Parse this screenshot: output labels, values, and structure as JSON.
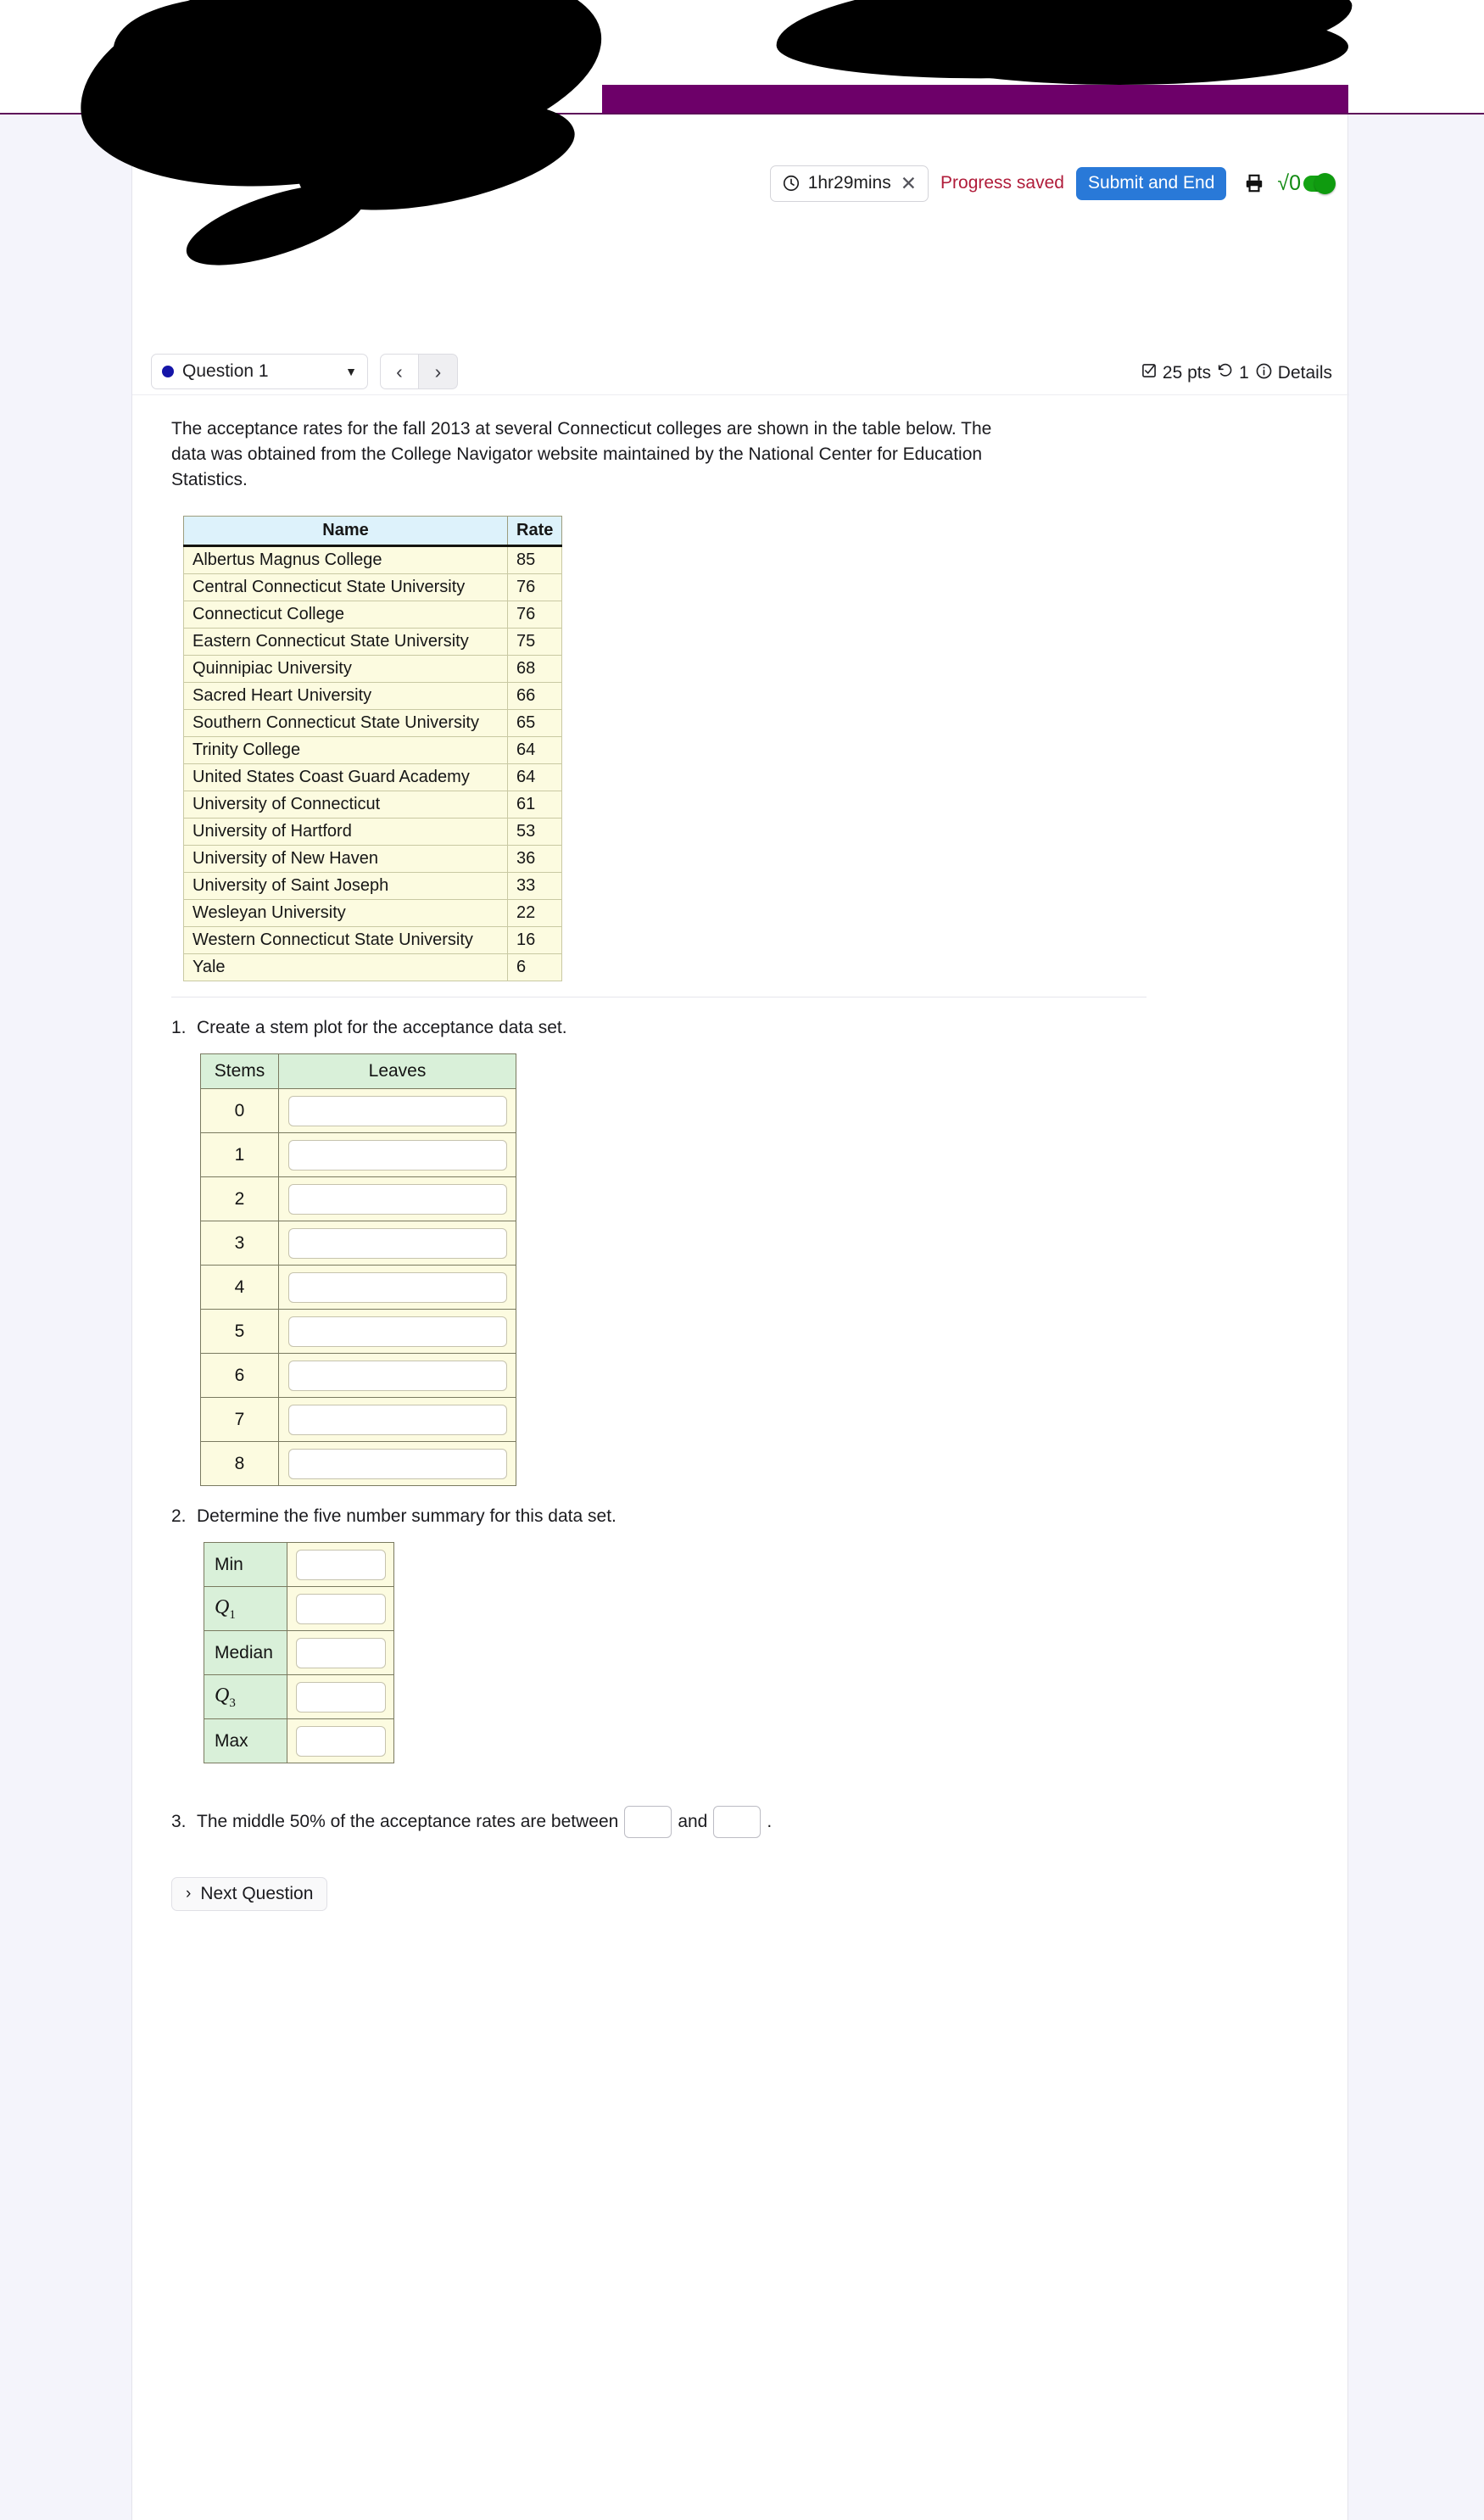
{
  "toolbar": {
    "timer_label": "1hr29mins",
    "timer_close": "✕",
    "progress_saved": "Progress saved",
    "submit_label": "Submit and End",
    "sqrt_glyph": "√0"
  },
  "qnav": {
    "question_label": "Question 1",
    "caret": "▼",
    "prev": "‹",
    "next": "›",
    "points": "25 pts",
    "attempts": "1",
    "details": "Details"
  },
  "main": {
    "prompt": "The acceptance rates for the fall 2013 at several Connecticut colleges are shown in the table below. The data was obtained from the College Navigator website maintained by the National Center for Education Statistics.",
    "next_question_label": "Next Question",
    "next_question_chevron": "›"
  },
  "data_table": {
    "headers": [
      "Name",
      "Rate"
    ],
    "rows": [
      [
        "Albertus Magnus College",
        "85"
      ],
      [
        "Central Connecticut State University",
        "76"
      ],
      [
        "Connecticut College",
        "76"
      ],
      [
        "Eastern Connecticut State University",
        "75"
      ],
      [
        "Quinnipiac University",
        "68"
      ],
      [
        "Sacred Heart University",
        "66"
      ],
      [
        "Southern Connecticut State University",
        "65"
      ],
      [
        "Trinity College",
        "64"
      ],
      [
        "United States Coast Guard Academy",
        "64"
      ],
      [
        "University of Connecticut",
        "61"
      ],
      [
        "University of Hartford",
        "53"
      ],
      [
        "University of New Haven",
        "36"
      ],
      [
        "University of Saint Joseph",
        "33"
      ],
      [
        "Wesleyan University",
        "22"
      ],
      [
        "Western Connecticut State University",
        "16"
      ],
      [
        "Yale",
        "6"
      ]
    ]
  },
  "questions": [
    {
      "num": "1.",
      "text": "Create a stem plot for the acceptance data set."
    },
    {
      "num": "2.",
      "text": "Determine the five number summary for this data set."
    },
    {
      "num": "3.",
      "text_before": "The middle 50% of the acceptance rates are between",
      "text_middle": "and",
      "text_after": "."
    }
  ],
  "stem_table": {
    "headers": [
      "Stems",
      "Leaves"
    ],
    "stems": [
      "0",
      "1",
      "2",
      "3",
      "4",
      "5",
      "6",
      "7",
      "8"
    ],
    "leaves": [
      "",
      "",
      "",
      "",
      "",
      "",
      "",
      "",
      ""
    ]
  },
  "five_number_summary": {
    "labels": [
      "Min",
      "Q1",
      "Median",
      "Q3",
      "Max"
    ],
    "label_parts": [
      {
        "main": "Min",
        "sub": ""
      },
      {
        "main": "Q",
        "sub": "1"
      },
      {
        "main": "Median",
        "sub": ""
      },
      {
        "main": "Q",
        "sub": "3"
      },
      {
        "main": "Max",
        "sub": ""
      }
    ],
    "values": [
      "",
      "",
      "",
      "",
      ""
    ]
  },
  "chart_data": {
    "type": "table",
    "title": "Acceptance rates for fall 2013 at Connecticut colleges",
    "categories": [
      "Albertus Magnus College",
      "Central Connecticut State University",
      "Connecticut College",
      "Eastern Connecticut State University",
      "Quinnipiac University",
      "Sacred Heart University",
      "Southern Connecticut State University",
      "Trinity College",
      "United States Coast Guard Academy",
      "University of Connecticut",
      "University of Hartford",
      "University of New Haven",
      "University of Saint Joseph",
      "Wesleyan University",
      "Western Connecticut State University",
      "Yale"
    ],
    "values": [
      85,
      76,
      76,
      75,
      68,
      66,
      65,
      64,
      64,
      61,
      53,
      36,
      33,
      22,
      16,
      6
    ],
    "xlabel": "Name",
    "ylabel": "Rate"
  },
  "colors": {
    "band_purple": "#6d0069",
    "band_blue": "#336a9e",
    "submit_blue": "#2979d8",
    "progress_red": "#b01c3a",
    "toggle_green": "#14a314",
    "table_header_blue": "#ddf2fb",
    "table_row_cream": "#fcfbe0",
    "stem_header_green": "#d9f0d9"
  }
}
